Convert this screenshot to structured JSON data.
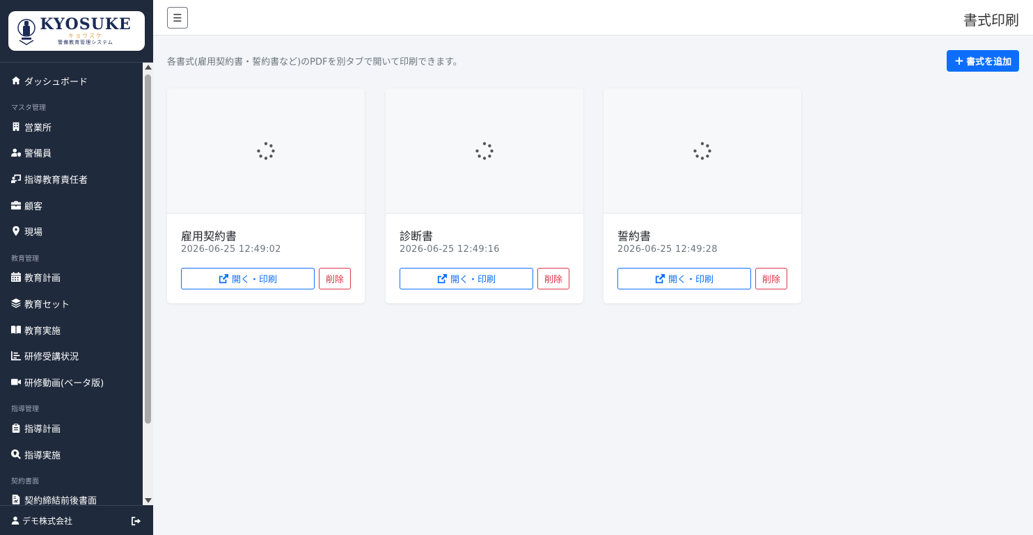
{
  "brand": {
    "title": "KYOSUKE",
    "kana": "キョウスケ",
    "subtitle": "警備教育管理システム"
  },
  "sidebar": {
    "items": [
      {
        "label": "ダッシュボード",
        "icon": "home-icon"
      },
      {
        "section": "マスタ管理"
      },
      {
        "label": "営業所",
        "icon": "building-icon"
      },
      {
        "label": "警備員",
        "icon": "user-shield-icon"
      },
      {
        "label": "指導教育責任者",
        "icon": "chalkboard-teacher-icon"
      },
      {
        "label": "顧客",
        "icon": "briefcase-icon"
      },
      {
        "label": "現場",
        "icon": "map-pin-icon"
      },
      {
        "section": "教育管理"
      },
      {
        "label": "教育計画",
        "icon": "calendar-icon"
      },
      {
        "label": "教育セット",
        "icon": "layers-icon"
      },
      {
        "label": "教育実施",
        "icon": "book-open-icon"
      },
      {
        "label": "研修受講状況",
        "icon": "chart-bar-icon"
      },
      {
        "label": "研修動画(ベータ版)",
        "icon": "video-icon"
      },
      {
        "section": "指導管理"
      },
      {
        "label": "指導計画",
        "icon": "clipboard-icon"
      },
      {
        "label": "指導実施",
        "icon": "search-location-icon"
      },
      {
        "section": "契約書面"
      },
      {
        "label": "契約締結前後書面",
        "icon": "file-contract-icon"
      }
    ],
    "footer": {
      "user_label": "デモ株式会社"
    }
  },
  "header": {
    "menu_glyph": "☰",
    "title": "書式印刷"
  },
  "main": {
    "description": "各書式(雇用契約書・誓約書など)のPDFを別タブで開いて印刷できます。",
    "add_button": {
      "plus": "+",
      "label": "書式を追加"
    },
    "cards": [
      {
        "title": "雇用契約書",
        "date": "2026-06-25 12:49:02",
        "open_label": "開く・印刷",
        "delete_label": "削除"
      },
      {
        "title": "診断書",
        "date": "2026-06-25 12:49:16",
        "open_label": "開く・印刷",
        "delete_label": "削除"
      },
      {
        "title": "誓約書",
        "date": "2026-06-25 12:49:28",
        "open_label": "開く・印刷",
        "delete_label": "削除"
      }
    ]
  },
  "colors": {
    "sidebar_bg": "#1f2a3c",
    "primary": "#0d6efd",
    "danger": "#dc3545",
    "page_bg": "#f3f5f8"
  }
}
